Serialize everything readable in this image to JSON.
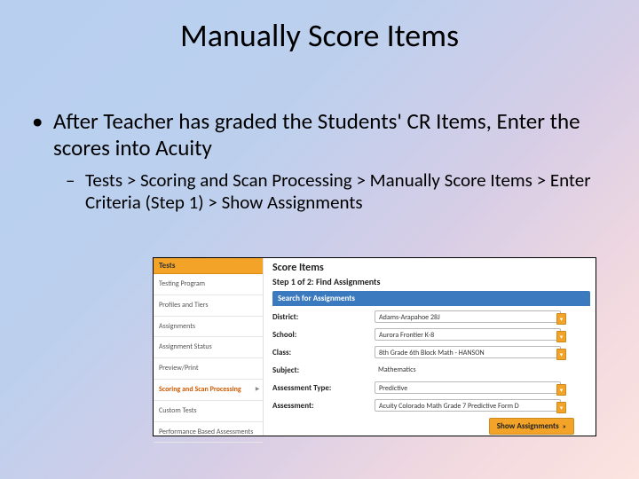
{
  "title": "Manually Score Items",
  "bullet1": "After Teacher has graded the Students' CR Items, Enter the scores into Acuity",
  "bullet2": "Tests > Scoring and Scan Processing > Manually Score Items > Enter Criteria (Step 1) > Show Assignments",
  "screenshot": {
    "sidebar": {
      "header": "Tests",
      "items": [
        "Testing Program",
        "Profiles and Tiers",
        "Assignments",
        "Assignment Status",
        "Preview/Print",
        "Scoring and Scan Processing",
        "Custom Tests",
        "Performance Based Assessments"
      ],
      "activeIndex": 5
    },
    "main": {
      "title": "Score Items",
      "subtitle": "Step 1 of 2: Find Assignments",
      "searchHeader": "Search for Assignments",
      "rows": [
        {
          "label": "District:",
          "value": "Adams-Arapahoe 28J",
          "dropdown": true
        },
        {
          "label": "School:",
          "value": "Aurora Frontier K-8",
          "dropdown": true
        },
        {
          "label": "Class:",
          "value": "8th Grade 6th Block Math - HANSON",
          "dropdown": true
        },
        {
          "label": "Subject:",
          "value": "Mathematics",
          "dropdown": false
        },
        {
          "label": "Assessment Type:",
          "value": "Predictive",
          "dropdown": true
        },
        {
          "label": "Assessment:",
          "value": "Acuity Colorado Math Grade 7 Predictive Form D",
          "dropdown": true
        }
      ],
      "button": "Show Assignments"
    }
  }
}
